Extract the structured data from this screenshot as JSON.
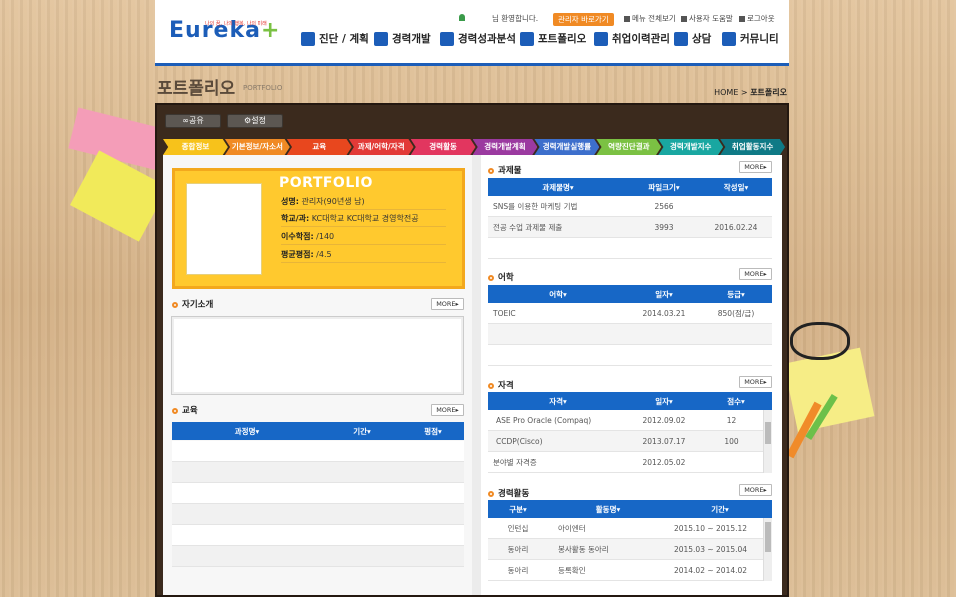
{
  "header": {
    "logo_text": "Eureka",
    "logo_plus": "+",
    "slogan": "나의 꿈, 나의 행복, 나의 미래",
    "welcome": "님 환영합니다.",
    "admin_button": "관리자 바로가기",
    "util_links": [
      "메뉴 전체보기",
      "사용자 도움말",
      "로그아웃"
    ],
    "nav": [
      "진단 / 계획",
      "경력개발",
      "경력성과분석",
      "포트폴리오",
      "취업이력관리",
      "상담",
      "커뮤니티"
    ]
  },
  "titlebar": {
    "title": "포트폴리오",
    "subtitle": "PORTFOLIO",
    "breadcrumb_home": "HOME",
    "breadcrumb_current": "포트폴리오"
  },
  "top_buttons": [
    "공유",
    "설정"
  ],
  "tabs": [
    {
      "label": "종합정보",
      "color": "#f7c21b"
    },
    {
      "label": "기본정보/자소서",
      "color": "#f08a24"
    },
    {
      "label": "교육",
      "color": "#e8471e"
    },
    {
      "label": "과제/어학/자격",
      "color": "#e23a37"
    },
    {
      "label": "경력활동",
      "color": "#e2365f"
    },
    {
      "label": "경력개발계획",
      "color": "#9b3aa0"
    },
    {
      "label": "경력개발실행률",
      "color": "#3d6fcc"
    },
    {
      "label": "역량진단결과",
      "color": "#7bc143"
    },
    {
      "label": "경력개발지수",
      "color": "#19a7a1"
    },
    {
      "label": "취업활동지수",
      "color": "#0f7a86"
    }
  ],
  "profile": {
    "card_title": "PORTFOLIO",
    "fields": [
      {
        "label": "성명:",
        "value": " 관리자(90년생 남)"
      },
      {
        "label": "학교/과:",
        "value": " KC대학교 KC대학교 경영학전공"
      },
      {
        "label": "이수학점:",
        "value": " /140"
      },
      {
        "label": "평균평점:",
        "value": " /4.5"
      }
    ]
  },
  "self_intro": {
    "title": "자기소개",
    "more": "MORE"
  },
  "education": {
    "title": "교육",
    "more": "MORE",
    "columns": [
      "과정명",
      "기간",
      "평점"
    ]
  },
  "assignment": {
    "title": "과제물",
    "more": "MORE",
    "columns": [
      "과제물명",
      "파일크기",
      "작성일"
    ],
    "rows": [
      [
        "SNS를 이용한 마케팅 기법",
        "2566",
        ""
      ],
      [
        "전공 수업 과제물 제출",
        "3993",
        "2016.02.24"
      ]
    ]
  },
  "language": {
    "title": "어학",
    "more": "MORE",
    "columns": [
      "어학",
      "일자",
      "등급"
    ],
    "rows": [
      [
        "TOEIC",
        "2014.03.21",
        "850(점/급)"
      ]
    ]
  },
  "license": {
    "title": "자격",
    "more": "MORE",
    "columns": [
      "자격",
      "일자",
      "점수"
    ],
    "rows": [
      [
        "ASE Pro Oracle (Compaq)",
        "2012.09.02",
        "12"
      ],
      [
        "CCDP(Cisco)",
        "2013.07.17",
        "100"
      ],
      [
        "분야별 자격증",
        "2012.05.02",
        ""
      ]
    ]
  },
  "activity": {
    "title": "경력활동",
    "more": "MORE",
    "columns": [
      "구분",
      "활동명",
      "기간"
    ],
    "rows": [
      [
        "인턴십",
        "아이엔터",
        "2015.10 ~ 2015.12"
      ],
      [
        "동아리",
        "봉사활동 동아리",
        "2015.03 ~ 2015.04"
      ],
      [
        "동아리",
        "등록확인",
        "2014.02 ~ 2014.02"
      ]
    ]
  },
  "colors": {
    "accent": "#1767c6",
    "frame": "#3b2a1d",
    "card": "#ffc92e"
  }
}
